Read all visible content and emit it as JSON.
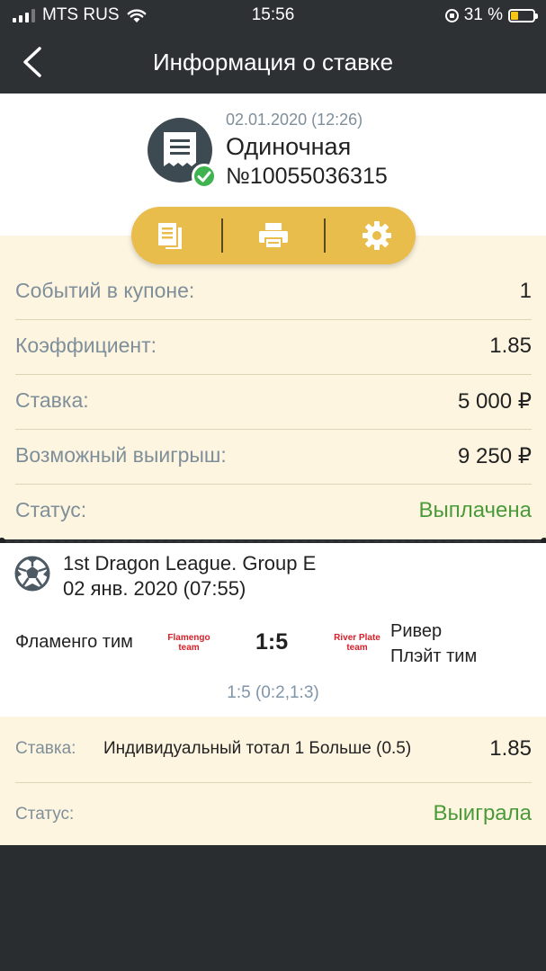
{
  "status_bar": {
    "carrier": "MTS RUS",
    "time": "15:56",
    "battery": "31 %"
  },
  "header": {
    "title": "Информация о ставке"
  },
  "bet": {
    "datetime": "02.01.2020 (12:26)",
    "type": "Одиночная",
    "number": "№10055036315"
  },
  "summary": {
    "rows": [
      {
        "label": "Событий в купоне:",
        "value": "1"
      },
      {
        "label": "Коэффициент:",
        "value": "1.85"
      },
      {
        "label": "Ставка:",
        "value": "5 000 ₽"
      },
      {
        "label": "Возможный выигрыш:",
        "value": "9 250 ₽"
      },
      {
        "label": "Статус:",
        "value": "Выплачена"
      }
    ]
  },
  "event": {
    "league": "1st Dragon League. Group E",
    "date": "02 янв. 2020 (07:55)",
    "team1": "Фламенго тим",
    "team1_logo": "Flamengo team",
    "score": "1:5",
    "team2_logo": "River Plate team",
    "team2_line1": "Ривер",
    "team2_line2": "Плэйт тим",
    "full_score": "1:5 (0:2,1:3)"
  },
  "detail": {
    "bet_label": "Ставка:",
    "bet_text": "Индивидуальный тотал 1 Больше (0.5)",
    "bet_coef": "1.85",
    "status_label": "Статус:",
    "status_value": "Выиграла"
  },
  "colors": {
    "accent": "#e8bd4c",
    "status_green": "#4a9a3a",
    "header_bg": "#2e3134",
    "cream_bg": "#fdf5e0"
  }
}
